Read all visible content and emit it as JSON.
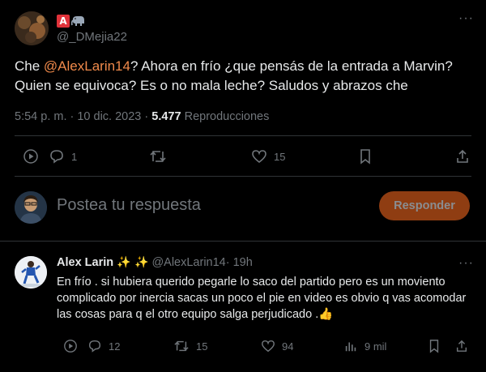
{
  "main_tweet": {
    "author_handle": "@_DMejia22",
    "badge_letter": "A",
    "text_before": "Che ",
    "mention": "@AlexLarin14",
    "text_after": "? Ahora en frío ¿que pensás de la entrada a Marvin? Quien se equivoca? Es o no mala leche? Saludos y abrazos che",
    "timestamp": "5:54 p. m. · 10 dic. 2023 · ",
    "views_count": "5.477",
    "views_label": " Reproducciones",
    "more_label": "···",
    "actions": {
      "replies": "1",
      "likes": "15"
    }
  },
  "reply_composer": {
    "placeholder": "Postea tu respuesta",
    "button_label": "Responder"
  },
  "reply_tweet": {
    "author_name": "Alex Larin",
    "emojis": "✨ ✨",
    "author_handle": "@AlexLarin14",
    "time": " · 19h",
    "text": "En frío . si hubiera querido pegarle lo saco del partido pero es un moviento complicado por inercia sacas un poco el pie en video es obvio q vas acomodar las cosas para q el otro equipo salga perjudicado .",
    "text_emoji": "👍",
    "more_label": "···",
    "actions": {
      "replies": "12",
      "retweets": "15",
      "likes": "94",
      "views": "9 mil"
    }
  },
  "colors": {
    "accent": "#f08a4b",
    "button_bg": "#8f3d12",
    "muted": "#71767b",
    "text": "#e7e9ea",
    "border": "#2f3336"
  }
}
